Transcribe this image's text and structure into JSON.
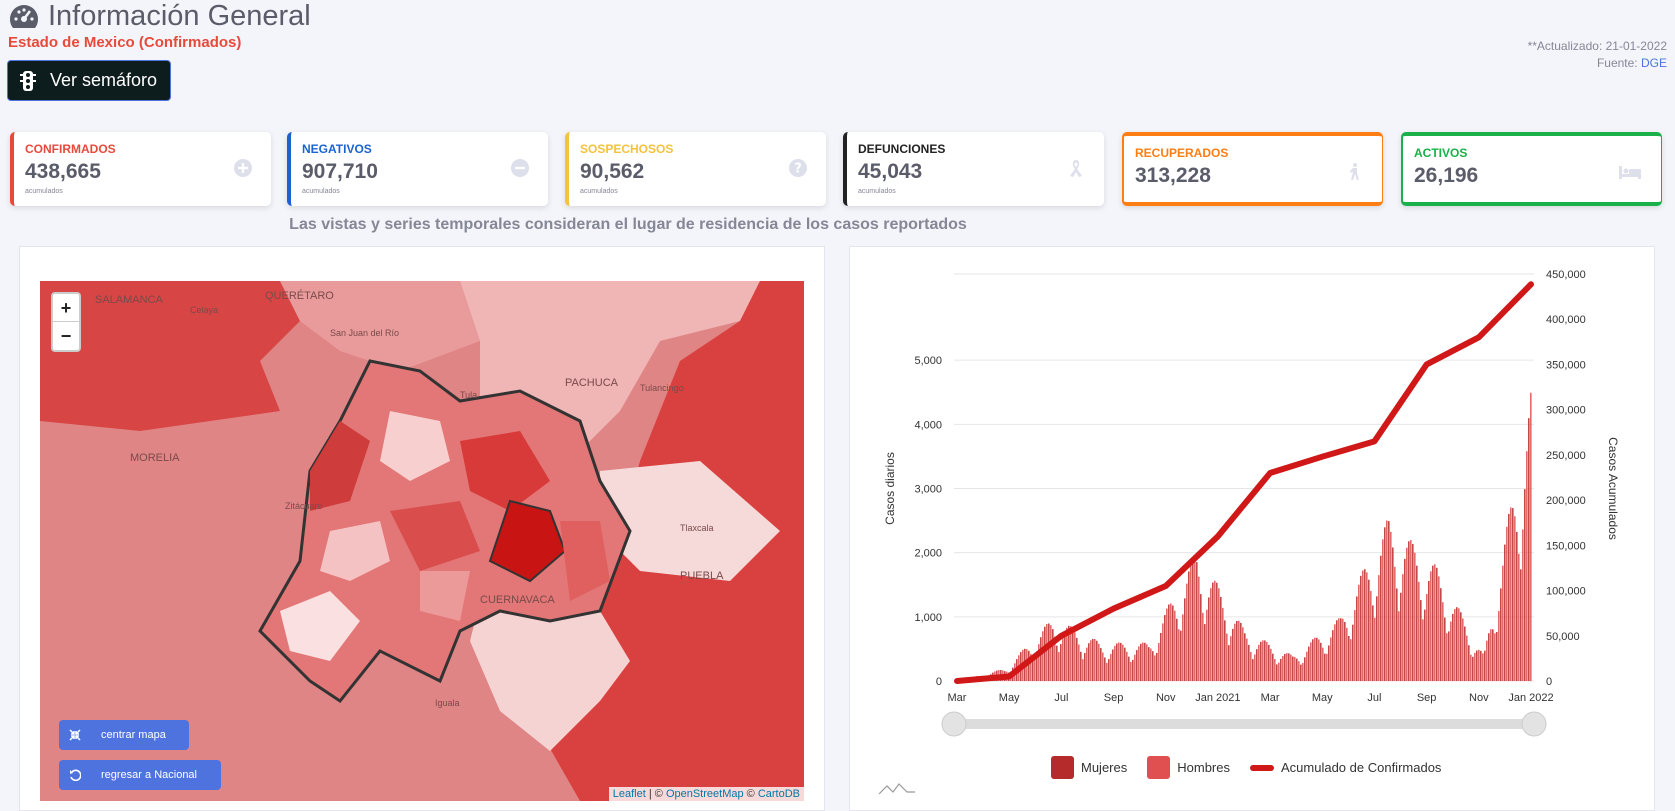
{
  "header": {
    "title": "Información General",
    "subtitle": "Estado de Mexico (Confirmados)",
    "semaforo_label": "Ver semáforo",
    "updated": "**Actualizado: 21-01-2022",
    "source_label": "Fuente:",
    "source_link": "DGE"
  },
  "cards": [
    {
      "label": "CONFIRMADOS",
      "value": "438,665",
      "sub": "acumulados",
      "color": "#e74a3b",
      "icon": "plus-circle-icon"
    },
    {
      "label": "NEGATIVOS",
      "value": "907,710",
      "sub": "acumulados",
      "color": "#1b63d1",
      "icon": "minus-circle-icon"
    },
    {
      "label": "SOSPECHOSOS",
      "value": "90,562",
      "sub": "acumulados",
      "color": "#f6c23e",
      "icon": "question-circle-icon"
    },
    {
      "label": "DEFUNCIONES",
      "value": "45,043",
      "sub": "acumulados",
      "color": "#222222",
      "icon": "ribbon-icon"
    },
    {
      "label": "RECUPERADOS",
      "value": "313,228",
      "color": "#fd7e14",
      "icon": "walking-icon"
    },
    {
      "label": "ACTIVOS",
      "value": "26,196",
      "color": "#1ab04a",
      "icon": "bed-icon"
    }
  ],
  "note": "Las vistas y series temporales consideran el lugar de residencia de los casos reportados",
  "map": {
    "zoom_in": "+",
    "zoom_out": "−",
    "center_button": "centrar mapa",
    "back_button": "regresar a Nacional",
    "attribution": {
      "leaflet": "Leaflet",
      "sep1": " | © ",
      "osm": "OpenStreetMap",
      "sep2": " © ",
      "carto": "CartoDB"
    },
    "place_labels": [
      "SALAMANCA",
      "Celaya",
      "QUERÉTARO",
      "San Juan del Río",
      "PACHUCA",
      "Tulancingo",
      "Tula",
      "MORELIA",
      "Zitácuaro",
      "Tlaxcala",
      "PUEBLA",
      "CUERNAVACA",
      "Iguala"
    ]
  },
  "chart_data": {
    "type": "bar",
    "x_ticks": [
      "Mar",
      "May",
      "Jul",
      "Sep",
      "Nov",
      "Jan 2021",
      "Mar",
      "May",
      "Jul",
      "Sep",
      "Nov",
      "Jan 2022"
    ],
    "ylabel": "Casos diarios",
    "ylabel_right": "Casos Acumulados",
    "ylim": [
      0,
      6000
    ],
    "y_ticks": [
      "0",
      "1,000",
      "2,000",
      "3,000",
      "4,000",
      "5,000"
    ],
    "ylim_right": [
      0,
      450000
    ],
    "y_ticks_right": [
      "0",
      "50,000",
      "100,000",
      "150,000",
      "200,000",
      "250,000",
      "300,000",
      "350,000",
      "400,000",
      "450,000"
    ],
    "series": [
      {
        "name": "Mujeres",
        "color": "#b52a2a"
      },
      {
        "name": "Hombres",
        "color": "#e05050"
      },
      {
        "name": "Acumulado de Confirmados",
        "color": "#d01818"
      }
    ],
    "daily_peaks": [
      {
        "x": "Mar",
        "value": 0
      },
      {
        "x": "May",
        "value": 200
      },
      {
        "x": "Jul",
        "value": 1000
      },
      {
        "x": "Sep",
        "value": 600
      },
      {
        "x": "Nov",
        "value": 600
      },
      {
        "x": "Jan 2021",
        "value": 2050
      },
      {
        "x": "Mar",
        "value": 800
      },
      {
        "x": "May",
        "value": 400
      },
      {
        "x": "Jul",
        "value": 1000
      },
      {
        "x": "Aug",
        "value": 2550
      },
      {
        "x": "Sep",
        "value": 1800
      },
      {
        "x": "Nov",
        "value": 400
      },
      {
        "x": "Jan 2022",
        "value": 4650
      }
    ],
    "cumulative": [
      {
        "x": "Mar",
        "value": 0
      },
      {
        "x": "May",
        "value": 5000
      },
      {
        "x": "Jul",
        "value": 50000
      },
      {
        "x": "Sep",
        "value": 80000
      },
      {
        "x": "Nov",
        "value": 105000
      },
      {
        "x": "Jan 2021",
        "value": 160000
      },
      {
        "x": "Mar",
        "value": 230000
      },
      {
        "x": "May",
        "value": 248000
      },
      {
        "x": "Jul",
        "value": 265000
      },
      {
        "x": "Sep",
        "value": 350000
      },
      {
        "x": "Nov",
        "value": 380000
      },
      {
        "x": "Jan 2022",
        "value": 438665
      }
    ]
  }
}
